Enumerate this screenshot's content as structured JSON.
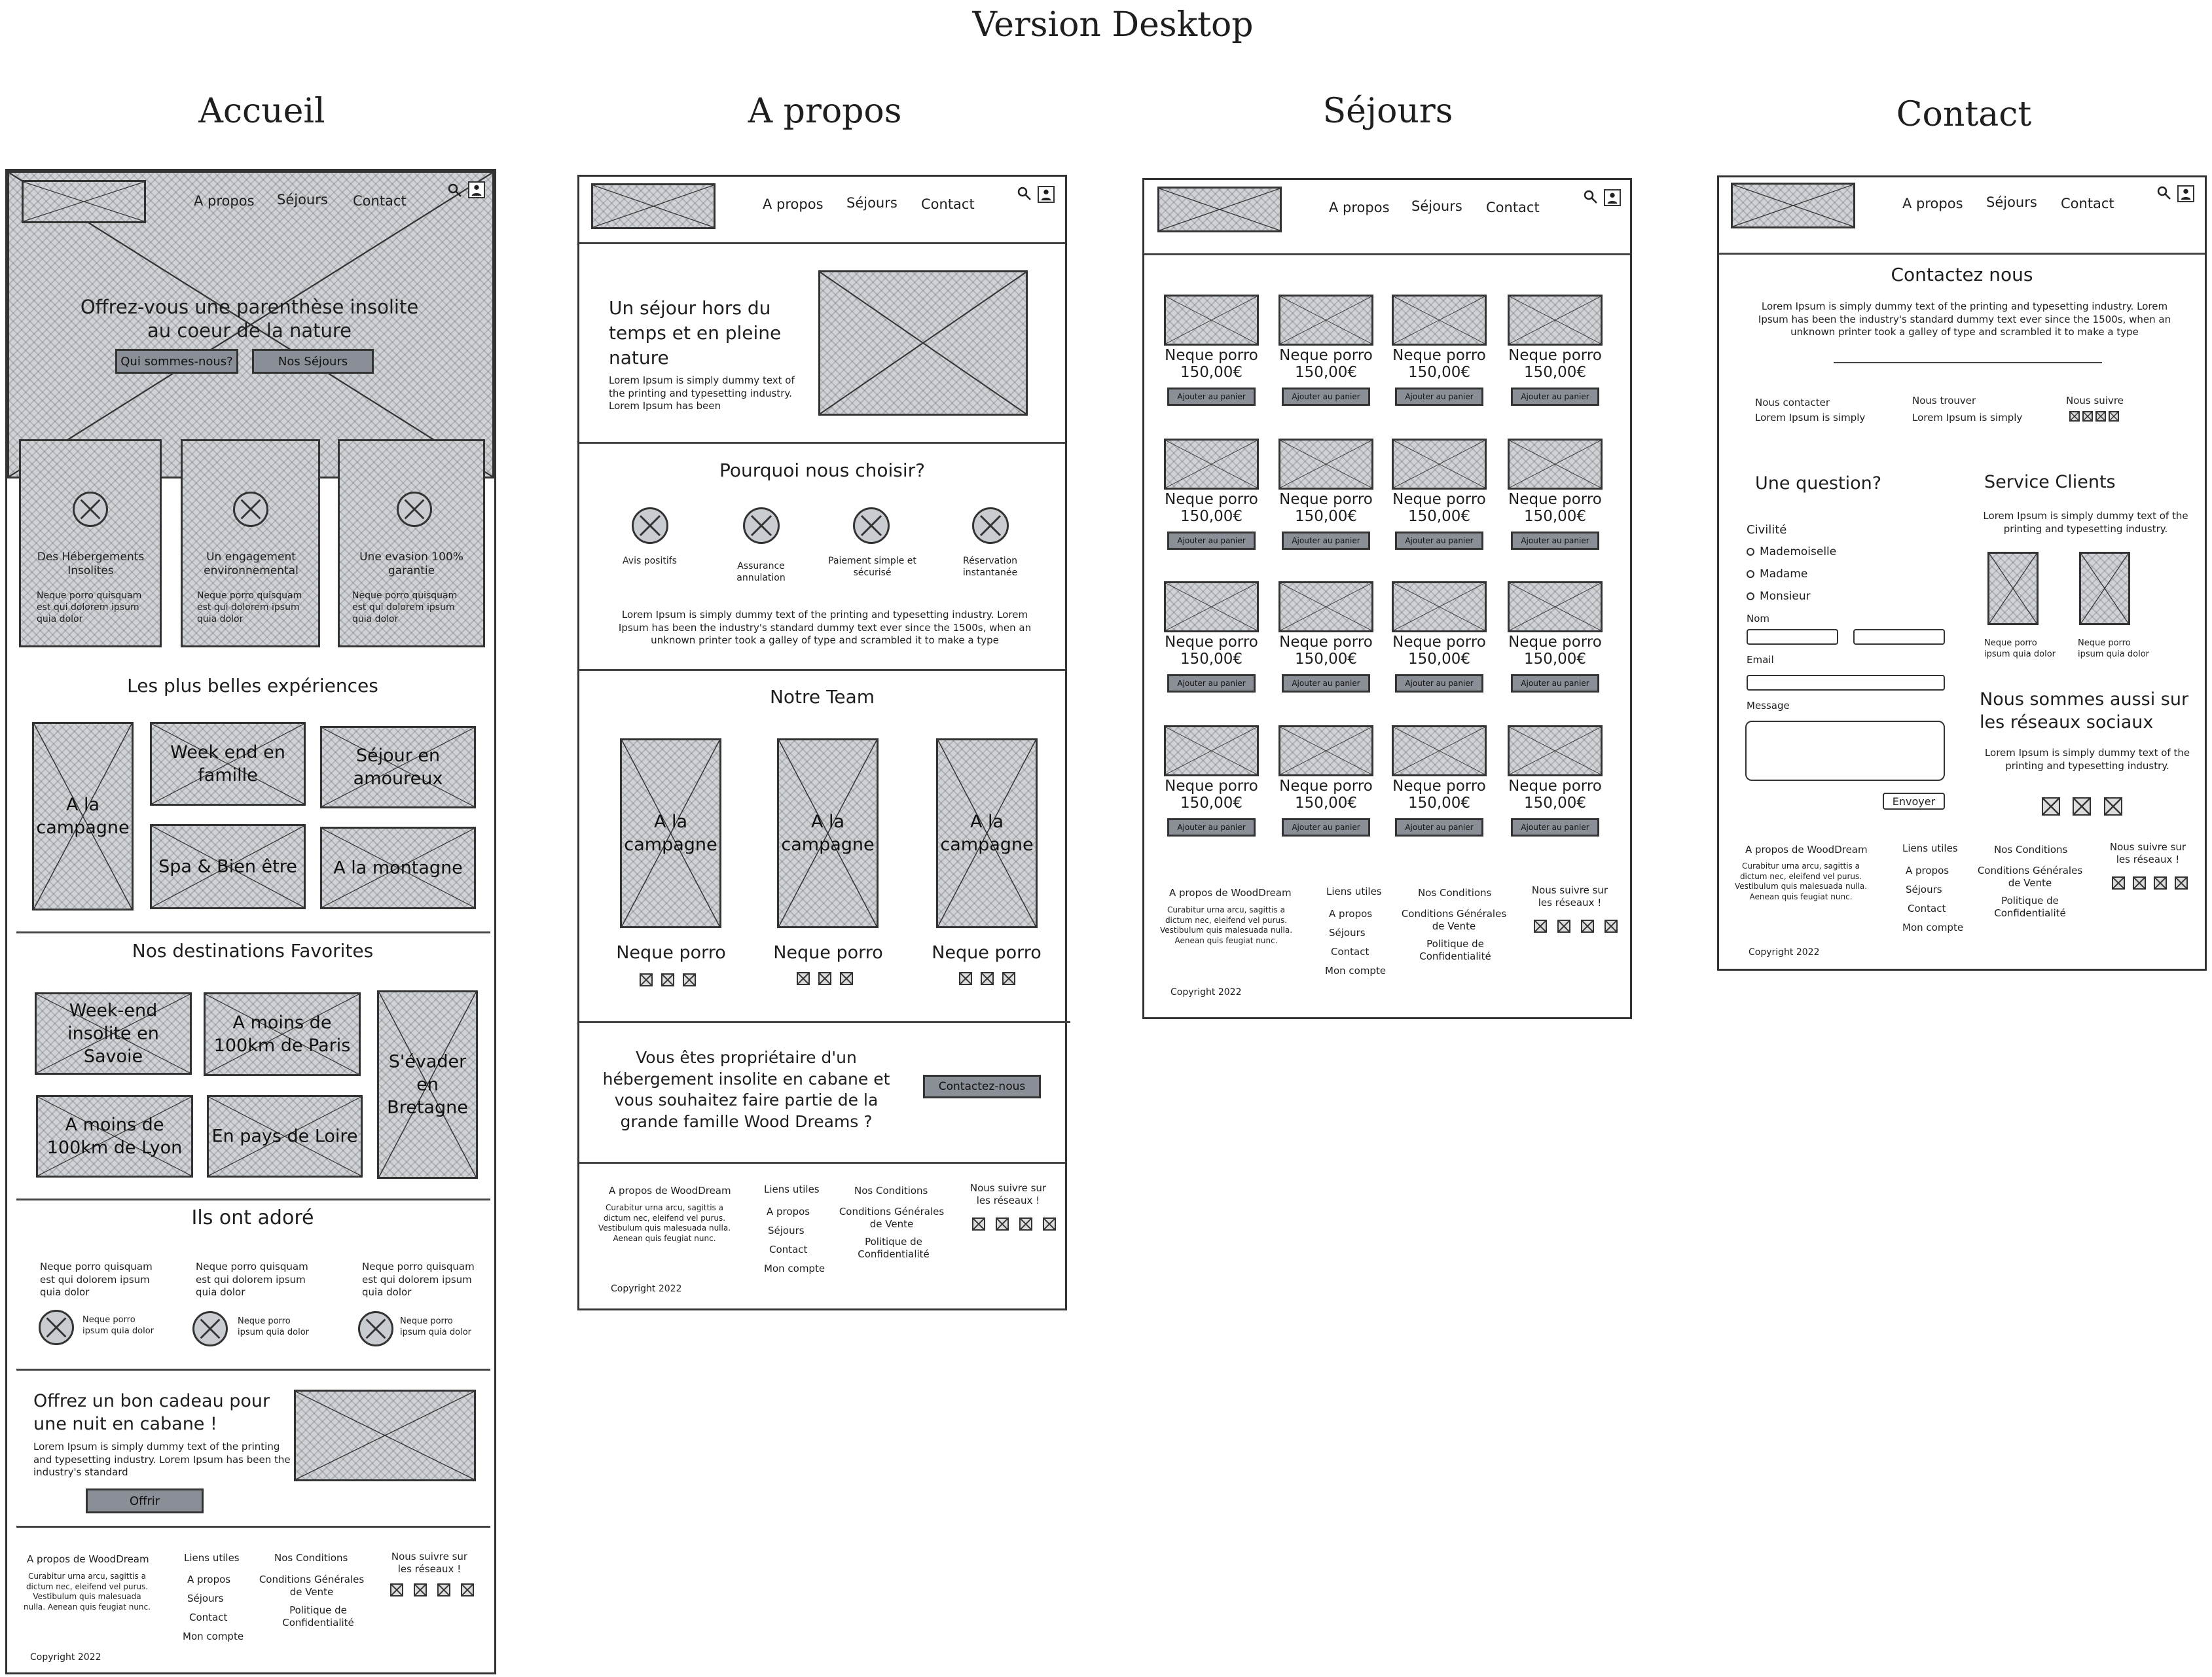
{
  "title": "Version Desktop",
  "page_titles": [
    "Accueil",
    "A propos",
    "Séjours",
    "Contact"
  ],
  "nav": {
    "a_propos": "A propos",
    "sejours": "Séjours",
    "contact": "Contact"
  },
  "accueil": {
    "hero_title": "Offrez-vous une parenthèse insolite au coeur de la nature",
    "btn_qui": "Qui sommes-nous?",
    "btn_sejours": "Nos Séjours",
    "features": [
      {
        "title": "Des Hébergements Insolites",
        "text": "Neque porro quisquam est qui dolorem ipsum quia dolor"
      },
      {
        "title": "Un engagement environnemental",
        "text": "Neque porro quisquam est qui dolorem ipsum quia dolor"
      },
      {
        "title": "Une evasion 100% garantie",
        "text": "Neque porro quisquam est qui dolorem ipsum quia dolor"
      }
    ],
    "exp_title": "Les plus belles expériences",
    "exp": [
      "A la campagne",
      "Week end en famille",
      "Séjour en amoureux",
      "Spa & Bien être",
      "A la montagne"
    ],
    "dest_title": "Nos destinations Favorites",
    "dest": [
      "Week-end insolite en Savoie",
      "A moins de 100km de Paris",
      "S'évader en Bretagne",
      "A moins de 100km de Lyon",
      "En pays de Loire"
    ],
    "adore_title": "Ils ont adoré",
    "reviews": [
      {
        "text": "Neque porro quisquam est qui dolorem ipsum quia dolor",
        "author": "Neque porro ipsum quia dolor"
      },
      {
        "text": "Neque porro quisquam est qui dolorem ipsum quia dolor",
        "author": "Neque porro ipsum quia dolor"
      },
      {
        "text": "Neque porro quisquam est qui dolorem ipsum quia dolor",
        "author": "Neque porro ipsum quia dolor"
      }
    ],
    "gift_title": "Offrez un bon cadeau pour une nuit en cabane !",
    "gift_text": "Lorem Ipsum is simply dummy text of the printing and typesetting industry. Lorem Ipsum has been the industry's standard",
    "gift_btn": "Offrir"
  },
  "apropos": {
    "hero_title": "Un séjour hors du temps et en pleine nature",
    "hero_text": "Lorem Ipsum is simply dummy text of the printing and typesetting industry. Lorem Ipsum has been",
    "why_title": "Pourquoi nous choisir?",
    "why": [
      "Avis positifs",
      "Assurance annulation",
      "Paiement simple et sécurisé",
      "Réservation instantanée"
    ],
    "why_text": "Lorem Ipsum is simply dummy text of the printing and typesetting industry. Lorem Ipsum has been the industry's standard dummy text ever since the 1500s, when an unknown printer took a galley of type and scrambled it to make a type",
    "team_title": "Notre Team",
    "team_photo": "A la campagne",
    "team_name": "Neque porro",
    "owner_text": "Vous êtes propriétaire d'un hébergement insolite en cabane et vous souhaitez faire partie de la grande famille Wood Dreams ?",
    "owner_btn": "Contactez-nous"
  },
  "sejours": {
    "item_name": "Neque porro",
    "item_price": "150,00€",
    "item_btn": "Ajouter au panier"
  },
  "contact": {
    "title": "Contactez nous",
    "intro": "Lorem Ipsum is simply dummy text of the printing and typesetting industry. Lorem Ipsum has been the industry's standard dummy text ever since the 1500s, when an unknown printer took a galley of type and scrambled it to make a type",
    "contacter": "Nous contacter",
    "contacter_text": "Lorem Ipsum is simply",
    "trouver": "Nous trouver",
    "trouver_text": "Lorem Ipsum is simply",
    "suivre": "Nous suivre",
    "question": "Une question?",
    "civilite": "Civilité",
    "options": [
      "Mademoiselle",
      "Madame",
      "Monsieur"
    ],
    "nom": "Nom",
    "email": "Email",
    "message": "Message",
    "envoyer": "Envoyer",
    "service": "Service Clients",
    "service_text": "Lorem Ipsum is simply dummy text of the printing and typesetting industry.",
    "staff_text": "Neque porro ipsum quia dolor",
    "social_title": "Nous sommes aussi sur les réseaux sociaux",
    "social_text": "Lorem Ipsum is simply dummy text of the printing and typesetting industry."
  },
  "footer": {
    "about_title": "A propos de WoodDream",
    "about_text": "Curabitur urna arcu, sagittis a dictum nec, eleifend vel purus. Vestibulum quis malesuada nulla. Aenean quis feugiat nunc.",
    "links_title": "Liens utiles",
    "links": [
      "A propos",
      "Séjours",
      "Contact",
      "Mon compte"
    ],
    "cond_title": "Nos Conditions",
    "cond1": "Conditions Générales de Vente",
    "cond2": "Politique de Confidentialité",
    "follow": "Nous suivre sur les réseaux !",
    "copyright": "Copyright 2022"
  }
}
